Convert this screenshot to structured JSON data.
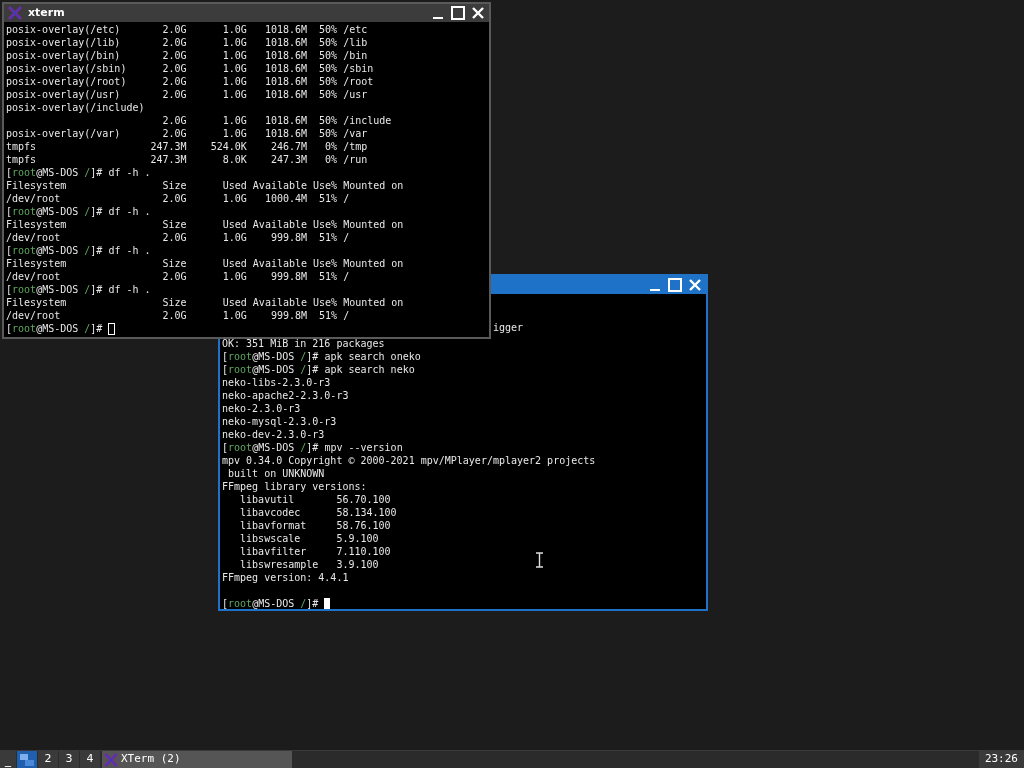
{
  "windows": [
    {
      "title": "xterm",
      "focused": false,
      "lines": [
        {
          "kind": "text",
          "text": "posix-overlay(/etc)       2.0G      1.0G   1018.6M  50% /etc"
        },
        {
          "kind": "text",
          "text": "posix-overlay(/lib)       2.0G      1.0G   1018.6M  50% /lib"
        },
        {
          "kind": "text",
          "text": "posix-overlay(/bin)       2.0G      1.0G   1018.6M  50% /bin"
        },
        {
          "kind": "text",
          "text": "posix-overlay(/sbin)      2.0G      1.0G   1018.6M  50% /sbin"
        },
        {
          "kind": "text",
          "text": "posix-overlay(/root)      2.0G      1.0G   1018.6M  50% /root"
        },
        {
          "kind": "text",
          "text": "posix-overlay(/usr)       2.0G      1.0G   1018.6M  50% /usr"
        },
        {
          "kind": "text",
          "text": "posix-overlay(/include)"
        },
        {
          "kind": "text",
          "text": "                          2.0G      1.0G   1018.6M  50% /include"
        },
        {
          "kind": "text",
          "text": "posix-overlay(/var)       2.0G      1.0G   1018.6M  50% /var"
        },
        {
          "kind": "text",
          "text": "tmpfs                   247.3M    524.0K    246.7M   0% /tmp"
        },
        {
          "kind": "text",
          "text": "tmpfs                   247.3M      8.0K    247.3M   0% /run"
        },
        {
          "kind": "prompt",
          "prefix": "[",
          "user": "root",
          "host": "@MS-DOS ",
          "dir": "/",
          "suffix": "]#",
          "command": "df -h ."
        },
        {
          "kind": "text",
          "text": "Filesystem                Size      Used Available Use% Mounted on"
        },
        {
          "kind": "text",
          "text": "/dev/root                 2.0G      1.0G   1000.4M  51% /"
        },
        {
          "kind": "prompt",
          "prefix": "[",
          "user": "root",
          "host": "@MS-DOS ",
          "dir": "/",
          "suffix": "]#",
          "command": "df -h ."
        },
        {
          "kind": "text",
          "text": "Filesystem                Size      Used Available Use% Mounted on"
        },
        {
          "kind": "text",
          "text": "/dev/root                 2.0G      1.0G    999.8M  51% /"
        },
        {
          "kind": "prompt",
          "prefix": "[",
          "user": "root",
          "host": "@MS-DOS ",
          "dir": "/",
          "suffix": "]#",
          "command": "df -h ."
        },
        {
          "kind": "text",
          "text": "Filesystem                Size      Used Available Use% Mounted on"
        },
        {
          "kind": "text",
          "text": "/dev/root                 2.0G      1.0G    999.8M  51% /"
        },
        {
          "kind": "prompt",
          "prefix": "[",
          "user": "root",
          "host": "@MS-DOS ",
          "dir": "/",
          "suffix": "]#",
          "command": "df -h ."
        },
        {
          "kind": "text",
          "text": "Filesystem                Size      Used Available Use% Mounted on"
        },
        {
          "kind": "text",
          "text": "/dev/root                 2.0G      1.0G    999.8M  51% /"
        },
        {
          "kind": "prompt",
          "prefix": "[",
          "user": "root",
          "host": "@MS-DOS ",
          "dir": "/",
          "suffix": "]#",
          "cursor": true
        }
      ]
    },
    {
      "focused": true,
      "lines": [
        {
          "kind": "tail",
          "text": "igger"
        },
        {
          "kind": "text",
          "text": "OK: 351 MiB in 216 packages"
        },
        {
          "kind": "prompt",
          "prefix": "[",
          "user": "root",
          "host": "@MS-DOS ",
          "dir": "/",
          "suffix": "]#",
          "command": "apk search oneko"
        },
        {
          "kind": "prompt",
          "prefix": "[",
          "user": "root",
          "host": "@MS-DOS ",
          "dir": "/",
          "suffix": "]#",
          "command": "apk search neko"
        },
        {
          "kind": "text",
          "text": "neko-libs-2.3.0-r3"
        },
        {
          "kind": "text",
          "text": "neko-apache2-2.3.0-r3"
        },
        {
          "kind": "text",
          "text": "neko-2.3.0-r3"
        },
        {
          "kind": "text",
          "text": "neko-mysql-2.3.0-r3"
        },
        {
          "kind": "text",
          "text": "neko-dev-2.3.0-r3"
        },
        {
          "kind": "prompt",
          "prefix": "[",
          "user": "root",
          "host": "@MS-DOS ",
          "dir": "/",
          "suffix": "]#",
          "command": "mpv --version"
        },
        {
          "kind": "text",
          "text": "mpv 0.34.0 Copyright © 2000-2021 mpv/MPlayer/mplayer2 projects"
        },
        {
          "kind": "text",
          "text": " built on UNKNOWN"
        },
        {
          "kind": "text",
          "text": "FFmpeg library versions:"
        },
        {
          "kind": "text",
          "text": "   libavutil       56.70.100"
        },
        {
          "kind": "text",
          "text": "   libavcodec      58.134.100"
        },
        {
          "kind": "text",
          "text": "   libavformat     58.76.100"
        },
        {
          "kind": "text",
          "text": "   libswscale      5.9.100"
        },
        {
          "kind": "text",
          "text": "   libavfilter     7.110.100"
        },
        {
          "kind": "text",
          "text": "   libswresample   3.9.100"
        },
        {
          "kind": "text",
          "text": "FFmpeg version: 4.4.1"
        },
        {
          "kind": "blank"
        },
        {
          "kind": "prompt",
          "prefix": "[",
          "user": "root",
          "host": "@MS-DOS ",
          "dir": "/",
          "suffix": "]#",
          "cursor": true
        }
      ]
    }
  ],
  "taskbar": {
    "show_desktop": "_",
    "workspaces": [
      {
        "kind": "icon",
        "selected": true
      },
      {
        "label": "2",
        "kind": "text",
        "selected": false
      },
      {
        "label": "3",
        "kind": "text",
        "selected": false
      },
      {
        "label": "4",
        "kind": "text",
        "selected": false
      }
    ],
    "tasks": [
      {
        "label": "XTerm (2)"
      }
    ],
    "clock": "23:26"
  }
}
